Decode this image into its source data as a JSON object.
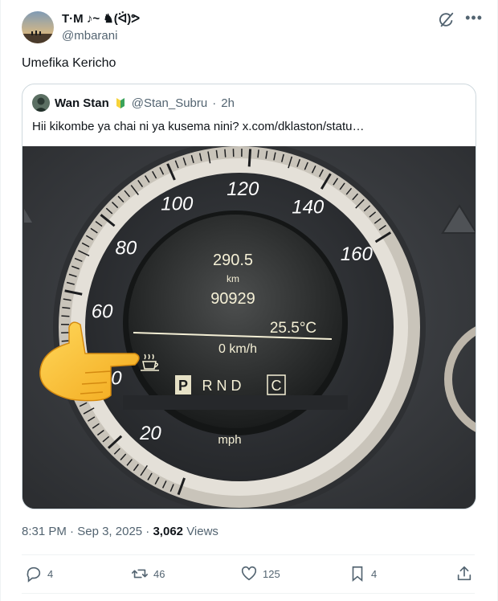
{
  "author": {
    "name": "T·M ♪~ ♞(ᐛ)ᕗ",
    "handle": "@mbarani"
  },
  "tweet": {
    "text": "Umefika Kericho"
  },
  "quoted": {
    "name": "Wan Stan",
    "handle": "@Stan_Subru",
    "separator": "·",
    "time": "2h",
    "text": "Hii kikombe ya chai ni ya kusema nini?  x.com/dklaston/statu…",
    "image": {
      "speed_labels": [
        "20",
        "40",
        "60",
        "80",
        "100",
        "120",
        "140",
        "160"
      ],
      "trip": "290.5",
      "trip_unit": "km",
      "odometer": "90929",
      "temperature": "25.5°C",
      "speed": "0 km/h",
      "gear_p": "P",
      "gear_rnd": "R N D",
      "mode": "C",
      "unit": "mph"
    }
  },
  "meta": {
    "time": "8:31 PM",
    "date": "Sep 3, 2025",
    "views_count": "3,062",
    "views_label": "Views"
  },
  "actions": {
    "replies": "4",
    "reposts": "46",
    "likes": "125",
    "bookmarks": "4"
  }
}
